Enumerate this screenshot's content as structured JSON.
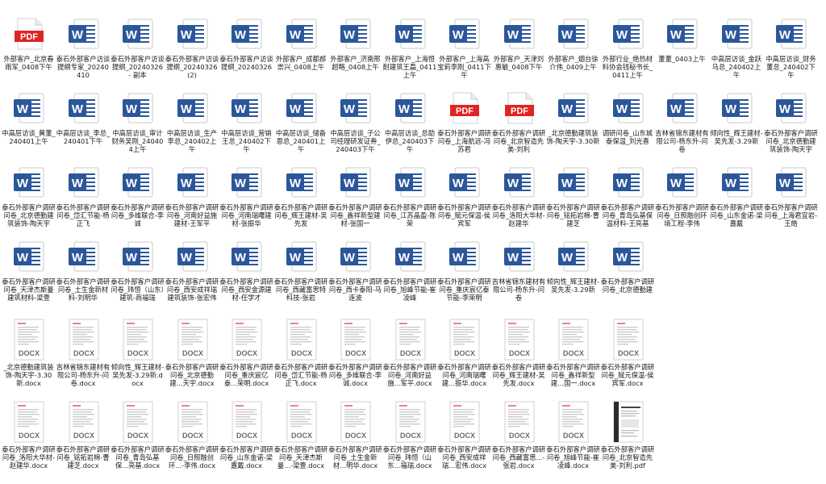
{
  "desktop": {
    "rows": [
      [
        {
          "type": "pdf",
          "label": "外部客户_北京春雨军_0408下午"
        },
        {
          "type": "word",
          "label": "泰石外部客户访谈提纲专家_20240410"
        },
        {
          "type": "word",
          "label": "泰石外部客户访谈提纲_20240326 - 副本"
        },
        {
          "type": "word",
          "label": "泰石外部客户访谈提纲_20240326(2)"
        },
        {
          "type": "word",
          "label": "泰石外部客户访谈提纲_20240326"
        },
        {
          "type": "word",
          "label": "外部客户_成都郝崇兴_0408上午"
        },
        {
          "type": "word",
          "label": "外部客户_济南邢超略_0408上午"
        },
        {
          "type": "word",
          "label": "外部客户_上海恒耐建筑王磊_0411上午"
        },
        {
          "type": "word",
          "label": "外部客户_上海高宝莉李刚_0411下午"
        },
        {
          "type": "word",
          "label": "外部客户_天津刘惠敏_0408下午"
        },
        {
          "type": "word",
          "label": "外部客户_烟台徐介伟_0409上午"
        },
        {
          "type": "word",
          "label": "外部行业_绝热材料协会钱秘书长_0411上午"
        },
        {
          "type": "word",
          "label": "董董_0403上午"
        },
        {
          "type": "word",
          "label": "中高层访谈_金跃马总_240402上午"
        },
        {
          "type": "word",
          "label": "中高层访谈_财务董总_240402下午"
        }
      ],
      [
        {
          "type": "word",
          "label": "中高层访谈_黄董_240401上午"
        },
        {
          "type": "word",
          "label": "中高层访谈_李总_240401下午"
        },
        {
          "type": "word",
          "label": "中高层访谈_审计财务吴刚_240404上午"
        },
        {
          "type": "word",
          "label": "中高层访谈_生产李总_240402上午"
        },
        {
          "type": "word",
          "label": "中高层访谈_营销王总_240402下午"
        },
        {
          "type": "word",
          "label": "中高层访谈_储备恩总_240401上午"
        },
        {
          "type": "word",
          "label": "中高层访谈_子公司经理研发证券_240403下午"
        },
        {
          "type": "word",
          "label": "中高层访谈_总助伊总_240403下午"
        },
        {
          "type": "pdf",
          "label": "泰石外部客户调研问卷_上海航远-冯苏君"
        },
        {
          "type": "pdf",
          "label": "泰石外部客户调研问卷_北京智造先美-刘利"
        },
        {
          "type": "word",
          "label": "_北京德勤建筑装饰-陶天宇-3.30新"
        },
        {
          "type": "word",
          "label": "调研问卷_山东城泰保温_刘光喜"
        },
        {
          "type": "word",
          "label": "吉林省锦东建材有限公司-杨东升-问卷"
        },
        {
          "type": "word",
          "label": "倾向性_辉王建材-吴先发-3.29新"
        },
        {
          "type": "word",
          "label": "泰石外部客户调研问卷_北京德勤建筑装饰-陶天宇"
        }
      ],
      [
        {
          "type": "word",
          "label": "泰石外部客户调研问卷_北京德勤建筑装饰-陶天宇"
        },
        {
          "type": "word",
          "label": "泰石外部客户调研问卷_岱汇节能-杨正飞"
        },
        {
          "type": "word",
          "label": "泰石外部客户调研问卷_多维联合-李诚"
        },
        {
          "type": "word",
          "label": "泰石外部客户调研问卷_河南好益施建材-王军平"
        },
        {
          "type": "word",
          "label": "泰石外部客户调研问卷_河南瑞曙建材-张振华"
        },
        {
          "type": "word",
          "label": "泰石外部客户调研问卷_辉王建材-吴先发"
        },
        {
          "type": "word",
          "label": "泰石外部客户调研问卷_鑫祥新型建材-张国一"
        },
        {
          "type": "word",
          "label": "泰石外部客户调研问卷_江苏晶盈-陈荣"
        },
        {
          "type": "word",
          "label": "泰石外部客户调研问卷_赋元保温-侯宾军"
        },
        {
          "type": "word",
          "label": "泰石外部客户调研问卷_洛阳大华材-赵建华"
        },
        {
          "type": "word",
          "label": "泰石外部客户调研问卷_铭拓岩棉-曹建芝"
        },
        {
          "type": "word",
          "label": "泰石外部客户调研问卷_青岛弘基保温材料-王亮基"
        },
        {
          "type": "word",
          "label": "泰石外部客户调研问卷_日照融创环境工程-李伟"
        },
        {
          "type": "word",
          "label": "泰石外部客户调研问卷_山东金诺-梁嘉戴"
        },
        {
          "type": "word",
          "label": "泰石外部客户调研问卷_上海君宜岩-王皓"
        }
      ],
      [
        {
          "type": "word",
          "label": "泰石外部客户调研问卷_天津杰斯曼建筑材料-梁壹"
        },
        {
          "type": "word",
          "label": "泰石外部客户调研问卷_土生金新材料-刘明华"
        },
        {
          "type": "word",
          "label": "泰石外部客户调研问卷_玮恒（山东）建筑-商福瑞"
        },
        {
          "type": "word",
          "label": "泰石外部客户调研问卷_西安成祥瑞建筑装饰-张宏伟"
        },
        {
          "type": "word",
          "label": "泰石外部客户调研问卷_西安金源建材-任学才"
        },
        {
          "type": "word",
          "label": "泰石外部客户调研问卷_西藏富思特科技-张岩"
        },
        {
          "type": "word",
          "label": "泰石外部客户调研问卷_西卡泰阳-马连波"
        },
        {
          "type": "word",
          "label": "泰石外部客户调研问卷_旭峰节能-崔凌峰"
        },
        {
          "type": "word",
          "label": "泰石外部客户调研问卷_重庆宸亿泰节能-李荣明"
        },
        {
          "type": "word",
          "label": "吉林省锦东建材有限公司-杨东升-问卷"
        },
        {
          "type": "word",
          "label": "倾向性_辉王建材-吴先发-3.29新"
        },
        {
          "type": "word",
          "label": "泰石外部客户调研问卷_北京德勤建"
        }
      ],
      [
        {
          "type": "docx",
          "label": "_北京德勤建筑装饰-陶天宇-3.30新.docx"
        },
        {
          "type": "docx",
          "label": "吉林省锦东建材有限公司-杨东升-问卷.docx"
        },
        {
          "type": "docx",
          "label": "倾向性_辉王建材-吴先发-3.29新.docx"
        },
        {
          "type": "docx",
          "label": "泰石外部客户调研问卷_北京德勤建...天宇.docx"
        },
        {
          "type": "docx",
          "label": "泰石外部客户调研问卷_重庆宸亿泰...荣明.docx"
        },
        {
          "type": "docx",
          "label": "泰石外部客户调研问卷_岱汇节能-杨正飞.docx"
        },
        {
          "type": "docx",
          "label": "泰石外部客户调研问卷_多维联合-李诚.docx"
        },
        {
          "type": "docx",
          "label": "泰石外部客户调研问卷_河南好益施...军平.docx"
        },
        {
          "type": "docx",
          "label": "泰石外部客户调研问卷_河南瑞曙建...振华.docx"
        },
        {
          "type": "docx",
          "label": "泰石外部客户调研问卷_辉王建材-吴先发.docx"
        },
        {
          "type": "docx",
          "label": "泰石外部客户调研问卷_鑫祥新型建...国一.docx"
        },
        {
          "type": "docx",
          "label": "泰石外部客户调研问卷_赋元保温-侯宾军.docx"
        }
      ],
      [
        {
          "type": "docx",
          "label": "泰石外部客户调研问卷_洛阳大华材-赵建华.docx"
        },
        {
          "type": "docx",
          "label": "泰石外部客户调研问卷_铭拓岩棉-曹建芝.docx"
        },
        {
          "type": "docx",
          "label": "泰石外部客户调研问卷_青岛弘基保...亮基.docx"
        },
        {
          "type": "docx",
          "label": "泰石外部客户调研问卷_日照融创环...-李伟.docx"
        },
        {
          "type": "docx",
          "label": "泰石外部客户调研问卷_山东金诺-梁嘉戴.docx"
        },
        {
          "type": "docx",
          "label": "泰石外部客户调研问卷_天津杰斯曼...-梁壹.docx"
        },
        {
          "type": "docx",
          "label": "泰石外部客户调研问卷_土生金新材...明华.docx"
        },
        {
          "type": "docx",
          "label": "泰石外部客户调研问卷_玮恒（山东...福瑞.docx"
        },
        {
          "type": "docx",
          "label": "泰石外部客户调研问卷_西安成祥瑞...宏伟.docx"
        },
        {
          "type": "docx",
          "label": "泰石外部客户调研问卷_西藏富思...-张岩.docx"
        },
        {
          "type": "docx",
          "label": "泰石外部客户调研问卷_旭峰节能-崔凌峰.docx"
        },
        {
          "type": "pdfthumb",
          "label": "泰石外部客户调研问卷_北京智造先美-刘利.pdf"
        }
      ]
    ],
    "icon_text": {
      "pdf": "PDF",
      "word": "W"
    },
    "colors": {
      "word_blue": "#2b579a",
      "pdf_red": "#e02424",
      "selection": "#cce8ff"
    }
  }
}
